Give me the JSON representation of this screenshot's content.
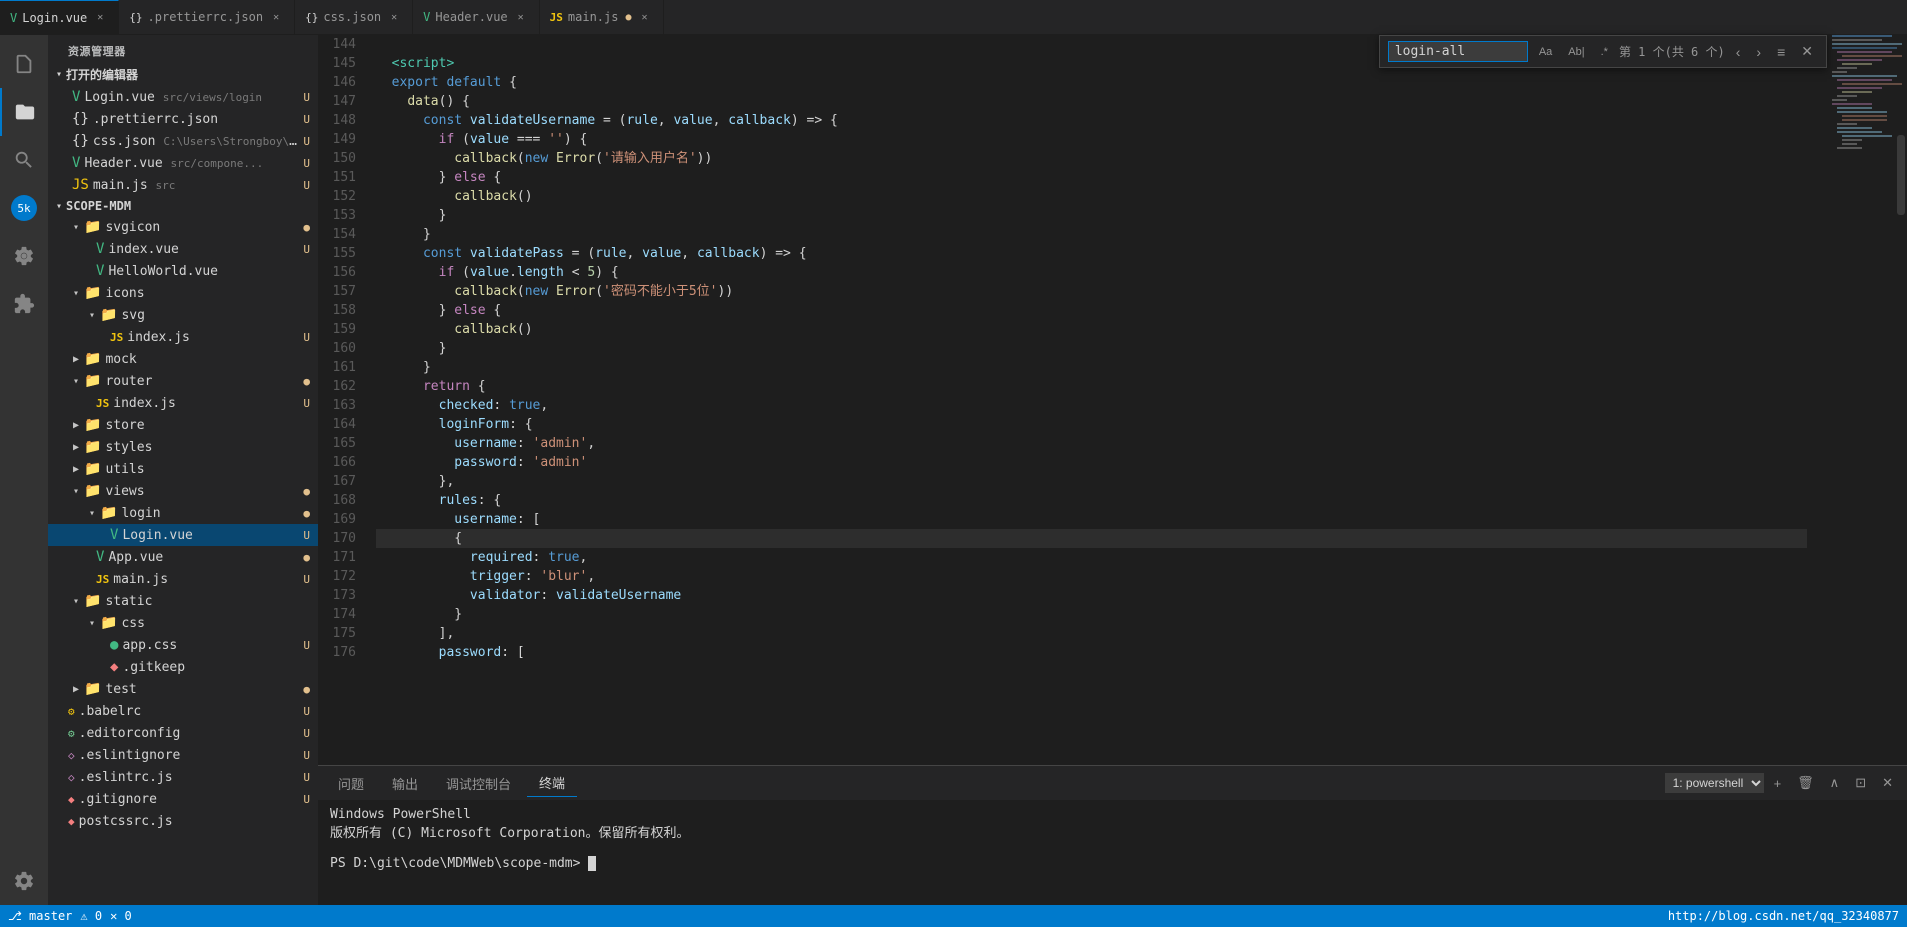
{
  "tabs": [
    {
      "id": "login-vue",
      "label": "Login.vue",
      "icon": "vue",
      "active": true,
      "modified": false,
      "path": ""
    },
    {
      "id": "prettierrc",
      "label": ".prettierrc.json",
      "icon": "json",
      "active": false,
      "modified": false
    },
    {
      "id": "css-json",
      "label": "css.json",
      "icon": "json",
      "active": false,
      "modified": false
    },
    {
      "id": "header-vue",
      "label": "Header.vue",
      "icon": "vue",
      "active": false,
      "modified": false
    },
    {
      "id": "main-js",
      "label": "main.js",
      "icon": "js",
      "active": false,
      "modified": true
    }
  ],
  "find_bar": {
    "input_value": "login-all",
    "count_text": "第 1 个(共 6 个)",
    "options": [
      "Aa",
      "Ab|",
      ".*"
    ]
  },
  "explorer": {
    "header": "资源管理器",
    "section_open": "打开的编辑器",
    "open_files": [
      {
        "label": "Login.vue",
        "path": "src/views/login",
        "icon": "vue",
        "badge": "U"
      },
      {
        "label": ".prettierrc.json",
        "path": "",
        "icon": "json",
        "badge": "U"
      },
      {
        "label": "css.json",
        "path": "C:\\Users\\Strongboy\\A...",
        "icon": "json",
        "badge": "U"
      },
      {
        "label": "Header.vue",
        "path": "src/compone...",
        "icon": "vue",
        "badge": "U"
      },
      {
        "label": "main.js",
        "path": "src",
        "icon": "js",
        "badge": "U"
      }
    ],
    "scope_mdm": "SCOPE-MDM",
    "tree": [
      {
        "id": "svgicon",
        "label": "svgicon",
        "type": "folder",
        "depth": 1,
        "open": true,
        "color": "folder"
      },
      {
        "id": "index-vue",
        "label": "index.vue",
        "type": "vue",
        "depth": 2,
        "badge": "U"
      },
      {
        "id": "helloworld-vue",
        "label": "HelloWorld.vue",
        "type": "vue",
        "depth": 2,
        "badge": ""
      },
      {
        "id": "icons",
        "label": "icons",
        "type": "folder-blue",
        "depth": 1,
        "open": true
      },
      {
        "id": "svg",
        "label": "svg",
        "type": "folder",
        "depth": 2,
        "open": true
      },
      {
        "id": "index-js-icons",
        "label": "index.js",
        "type": "js",
        "depth": 3,
        "badge": "U"
      },
      {
        "id": "mock",
        "label": "mock",
        "type": "folder-green",
        "depth": 1
      },
      {
        "id": "router",
        "label": "router",
        "type": "folder-green",
        "depth": 1,
        "open": true
      },
      {
        "id": "index-js-router",
        "label": "index.js",
        "type": "js",
        "depth": 2,
        "badge": "U"
      },
      {
        "id": "store",
        "label": "store",
        "type": "folder-blue",
        "depth": 1
      },
      {
        "id": "styles",
        "label": "styles",
        "type": "folder-blue",
        "depth": 1
      },
      {
        "id": "utils",
        "label": "utils",
        "type": "folder-blue",
        "depth": 1
      },
      {
        "id": "views",
        "label": "views",
        "type": "folder-green",
        "depth": 1,
        "open": true
      },
      {
        "id": "login",
        "label": "login",
        "type": "folder-green",
        "depth": 2,
        "open": true
      },
      {
        "id": "login-vue-tree",
        "label": "Login.vue",
        "type": "vue",
        "depth": 3,
        "badge": "U"
      },
      {
        "id": "app-vue",
        "label": "App.vue",
        "type": "vue",
        "depth": 2,
        "badge": ""
      },
      {
        "id": "main-js-tree",
        "label": "main.js",
        "type": "js",
        "depth": 2,
        "badge": "U"
      },
      {
        "id": "static",
        "label": "static",
        "type": "folder",
        "depth": 1,
        "open": true
      },
      {
        "id": "css",
        "label": "css",
        "type": "folder-blue",
        "depth": 2,
        "open": true
      },
      {
        "id": "app-css",
        "label": "app.css",
        "type": "css",
        "depth": 3,
        "badge": "U"
      },
      {
        "id": "gitkeep",
        "label": ".gitkeep",
        "type": "git",
        "depth": 3
      },
      {
        "id": "test",
        "label": "test",
        "type": "folder-red",
        "depth": 1
      },
      {
        "id": "babelrc",
        "label": ".babelrc",
        "type": "babel",
        "depth": 0,
        "badge": "U"
      },
      {
        "id": "editorconfig",
        "label": ".editorconfig",
        "type": "editor",
        "depth": 0,
        "badge": "U"
      },
      {
        "id": "eslintignore",
        "label": ".eslintignore",
        "type": "eslint",
        "depth": 0,
        "badge": "U"
      },
      {
        "id": "eslintrc",
        "label": ".eslintrc.js",
        "type": "eslint",
        "depth": 0,
        "badge": "U"
      },
      {
        "id": "gitignore",
        "label": ".gitignore",
        "type": "git",
        "depth": 0,
        "badge": "U"
      },
      {
        "id": "postcssrc",
        "label": "postcssrc.js",
        "type": "js",
        "depth": 0
      }
    ]
  },
  "code": {
    "lines": [
      {
        "num": 144,
        "content": ""
      },
      {
        "num": 145,
        "content": "  <script>",
        "type": "tag"
      },
      {
        "num": 146,
        "content": "  export default {",
        "tokens": [
          {
            "t": "kw",
            "v": "export"
          },
          {
            "t": "kw",
            "v": "default"
          },
          {
            "t": "punc",
            "v": " {"
          }
        ]
      },
      {
        "num": 147,
        "content": "    data() {",
        "tokens": [
          {
            "t": "fn",
            "v": "data"
          },
          {
            "t": "punc",
            "v": "() {"
          }
        ]
      },
      {
        "num": 148,
        "content": "      const validateUsername = (rule, value, callback) => {",
        "tokens": [
          {
            "t": "kw",
            "v": "const"
          },
          {
            "t": "var",
            "v": " validateUsername"
          },
          {
            "t": "punc",
            "v": " = ("
          },
          {
            "t": "var",
            "v": "rule"
          },
          {
            "t": "punc",
            "v": ", "
          },
          {
            "t": "var",
            "v": "value"
          },
          {
            "t": "punc",
            "v": ", "
          },
          {
            "t": "var",
            "v": "callback"
          },
          {
            "t": "punc",
            "v": ") => {"
          }
        ]
      },
      {
        "num": 149,
        "content": "        if (value === '') {",
        "tokens": [
          {
            "t": "kw2",
            "v": "if"
          },
          {
            "t": "punc",
            "v": " ("
          },
          {
            "t": "var",
            "v": "value"
          },
          {
            "t": "punc",
            "v": " === "
          },
          {
            "t": "str",
            "v": "''"
          },
          {
            "t": "punc",
            "v": ") {"
          }
        ]
      },
      {
        "num": 150,
        "content": "          callback(new Error('请输入用户名'))",
        "tokens": [
          {
            "t": "fn",
            "v": "callback"
          },
          {
            "t": "punc",
            "v": "("
          },
          {
            "t": "kw",
            "v": "new"
          },
          {
            "t": "fn",
            "v": " Error"
          },
          {
            "t": "punc",
            "v": "("
          },
          {
            "t": "str",
            "v": "'请输入用户名'"
          },
          {
            "t": "punc",
            "v": "))"
          }
        ]
      },
      {
        "num": 151,
        "content": "        } else {",
        "tokens": [
          {
            "t": "punc",
            "v": "        } "
          },
          {
            "t": "kw2",
            "v": "else"
          },
          {
            "t": "punc",
            "v": " {"
          }
        ]
      },
      {
        "num": 152,
        "content": "          callback()",
        "tokens": [
          {
            "t": "fn",
            "v": "          callback"
          },
          {
            "t": "punc",
            "v": "()"
          }
        ]
      },
      {
        "num": 153,
        "content": "        }",
        "tokens": [
          {
            "t": "punc",
            "v": "        }"
          }
        ]
      },
      {
        "num": 154,
        "content": "      }",
        "tokens": [
          {
            "t": "punc",
            "v": "      }"
          }
        ]
      },
      {
        "num": 155,
        "content": "      const validatePass = (rule, value, callback) => {",
        "tokens": [
          {
            "t": "kw",
            "v": "const"
          },
          {
            "t": "var",
            "v": " validatePass"
          },
          {
            "t": "punc",
            "v": " = ("
          },
          {
            "t": "var",
            "v": "rule"
          },
          {
            "t": "punc",
            "v": ", "
          },
          {
            "t": "var",
            "v": "value"
          },
          {
            "t": "punc",
            "v": ", "
          },
          {
            "t": "var",
            "v": "callback"
          },
          {
            "t": "punc",
            "v": ") => {"
          }
        ]
      },
      {
        "num": 156,
        "content": "        if (value.length < 5) {",
        "tokens": [
          {
            "t": "kw2",
            "v": "if"
          },
          {
            "t": "punc",
            "v": " ("
          },
          {
            "t": "var",
            "v": "value"
          },
          {
            "t": "punc",
            "v": "."
          },
          {
            "t": "prop",
            "v": "length"
          },
          {
            "t": "punc",
            "v": " < "
          },
          {
            "t": "num",
            "v": "5"
          },
          {
            "t": "punc",
            "v": ") {"
          }
        ]
      },
      {
        "num": 157,
        "content": "          callback(new Error('密码不能小于5位'))",
        "tokens": [
          {
            "t": "fn",
            "v": "callback"
          },
          {
            "t": "punc",
            "v": "("
          },
          {
            "t": "kw",
            "v": "new"
          },
          {
            "t": "fn",
            "v": " Error"
          },
          {
            "t": "punc",
            "v": "("
          },
          {
            "t": "str",
            "v": "'密码不能小于5位'"
          },
          {
            "t": "punc",
            "v": "))"
          }
        ]
      },
      {
        "num": 158,
        "content": "        } else {",
        "tokens": [
          {
            "t": "punc",
            "v": "        } "
          },
          {
            "t": "kw2",
            "v": "else"
          },
          {
            "t": "punc",
            "v": " {"
          }
        ]
      },
      {
        "num": 159,
        "content": "          callback()",
        "tokens": [
          {
            "t": "fn",
            "v": "          callback"
          },
          {
            "t": "punc",
            "v": "()"
          }
        ]
      },
      {
        "num": 160,
        "content": "        }",
        "tokens": [
          {
            "t": "punc",
            "v": "        }"
          }
        ]
      },
      {
        "num": 161,
        "content": "      }",
        "tokens": [
          {
            "t": "punc",
            "v": "      }"
          }
        ]
      },
      {
        "num": 162,
        "content": "      return {",
        "tokens": [
          {
            "t": "kw2",
            "v": "      return"
          },
          {
            "t": "punc",
            "v": " {"
          }
        ]
      },
      {
        "num": 163,
        "content": "        checked: true,",
        "tokens": [
          {
            "t": "prop",
            "v": "        checked"
          },
          {
            "t": "punc",
            "v": ": "
          },
          {
            "t": "bool",
            "v": "true"
          },
          {
            "t": "punc",
            "v": ","
          }
        ]
      },
      {
        "num": 164,
        "content": "        loginForm: {",
        "tokens": [
          {
            "t": "prop",
            "v": "        loginForm"
          },
          {
            "t": "punc",
            "v": ": {"
          }
        ]
      },
      {
        "num": 165,
        "content": "          username: 'admin',",
        "tokens": [
          {
            "t": "prop",
            "v": "          username"
          },
          {
            "t": "punc",
            "v": ": "
          },
          {
            "t": "str",
            "v": "'admin'"
          },
          {
            "t": "punc",
            "v": ","
          }
        ]
      },
      {
        "num": 166,
        "content": "          password: 'admin'",
        "tokens": [
          {
            "t": "prop",
            "v": "          password"
          },
          {
            "t": "punc",
            "v": ": "
          },
          {
            "t": "str",
            "v": "'admin'"
          }
        ]
      },
      {
        "num": 167,
        "content": "        },",
        "tokens": [
          {
            "t": "punc",
            "v": "        },"
          }
        ]
      },
      {
        "num": 168,
        "content": "        rules: {",
        "tokens": [
          {
            "t": "prop",
            "v": "        rules"
          },
          {
            "t": "punc",
            "v": ": {"
          }
        ]
      },
      {
        "num": 169,
        "content": "          username: [",
        "tokens": [
          {
            "t": "prop",
            "v": "          username"
          },
          {
            "t": "punc",
            "v": ": ["
          }
        ]
      },
      {
        "num": 170,
        "content": "          {",
        "tokens": [
          {
            "t": "punc",
            "v": "          {"
          }
        ]
      },
      {
        "num": 171,
        "content": "            required: true,",
        "tokens": [
          {
            "t": "prop",
            "v": "            required"
          },
          {
            "t": "punc",
            "v": ": "
          },
          {
            "t": "bool",
            "v": "true"
          },
          {
            "t": "punc",
            "v": ","
          }
        ]
      },
      {
        "num": 172,
        "content": "            trigger: 'blur',",
        "tokens": [
          {
            "t": "prop",
            "v": "            trigger"
          },
          {
            "t": "punc",
            "v": ": "
          },
          {
            "t": "str",
            "v": "'blur'"
          },
          {
            "t": "punc",
            "v": ","
          }
        ]
      },
      {
        "num": 173,
        "content": "            validator: validateUsername",
        "tokens": [
          {
            "t": "prop",
            "v": "            validator"
          },
          {
            "t": "punc",
            "v": ": "
          },
          {
            "t": "var",
            "v": "validateUsername"
          }
        ]
      },
      {
        "num": 174,
        "content": "          }",
        "tokens": [
          {
            "t": "punc",
            "v": "          }"
          }
        ]
      },
      {
        "num": 175,
        "content": "        ],",
        "tokens": [
          {
            "t": "punc",
            "v": "        ],"
          }
        ]
      },
      {
        "num": 176,
        "content": "        password: [",
        "tokens": [
          {
            "t": "prop",
            "v": "        password"
          },
          {
            "t": "punc",
            "v": ": ["
          }
        ]
      }
    ]
  },
  "terminal": {
    "tabs": [
      {
        "label": "问题",
        "active": false
      },
      {
        "label": "输出",
        "active": false
      },
      {
        "label": "调试控制台",
        "active": false
      },
      {
        "label": "终端",
        "active": true
      }
    ],
    "lines": [
      "Windows  PowerShell",
      "版权所有 (C) Microsoft Corporation。保留所有权利。",
      "",
      "PS D:\\git\\code\\MDMWeb\\scope-mdm> █"
    ],
    "dropdown": "1: powershell"
  },
  "status_bar": {
    "left": [
      "⎇ master",
      "⚠ 0",
      "✕ 0"
    ],
    "right": [
      "http://blog.csdn.net/qq_32340877"
    ]
  },
  "activity_bar": {
    "icons": [
      {
        "name": "files-icon",
        "symbol": "⎘",
        "active": false
      },
      {
        "name": "explorer-icon",
        "symbol": "🗂",
        "active": true
      },
      {
        "name": "search-icon",
        "symbol": "🔍",
        "active": false
      },
      {
        "name": "git-icon",
        "symbol": "⌥",
        "active": false
      },
      {
        "name": "debug-icon",
        "symbol": "🐛",
        "active": false
      },
      {
        "name": "extensions-icon",
        "symbol": "⊞",
        "active": false
      }
    ]
  }
}
